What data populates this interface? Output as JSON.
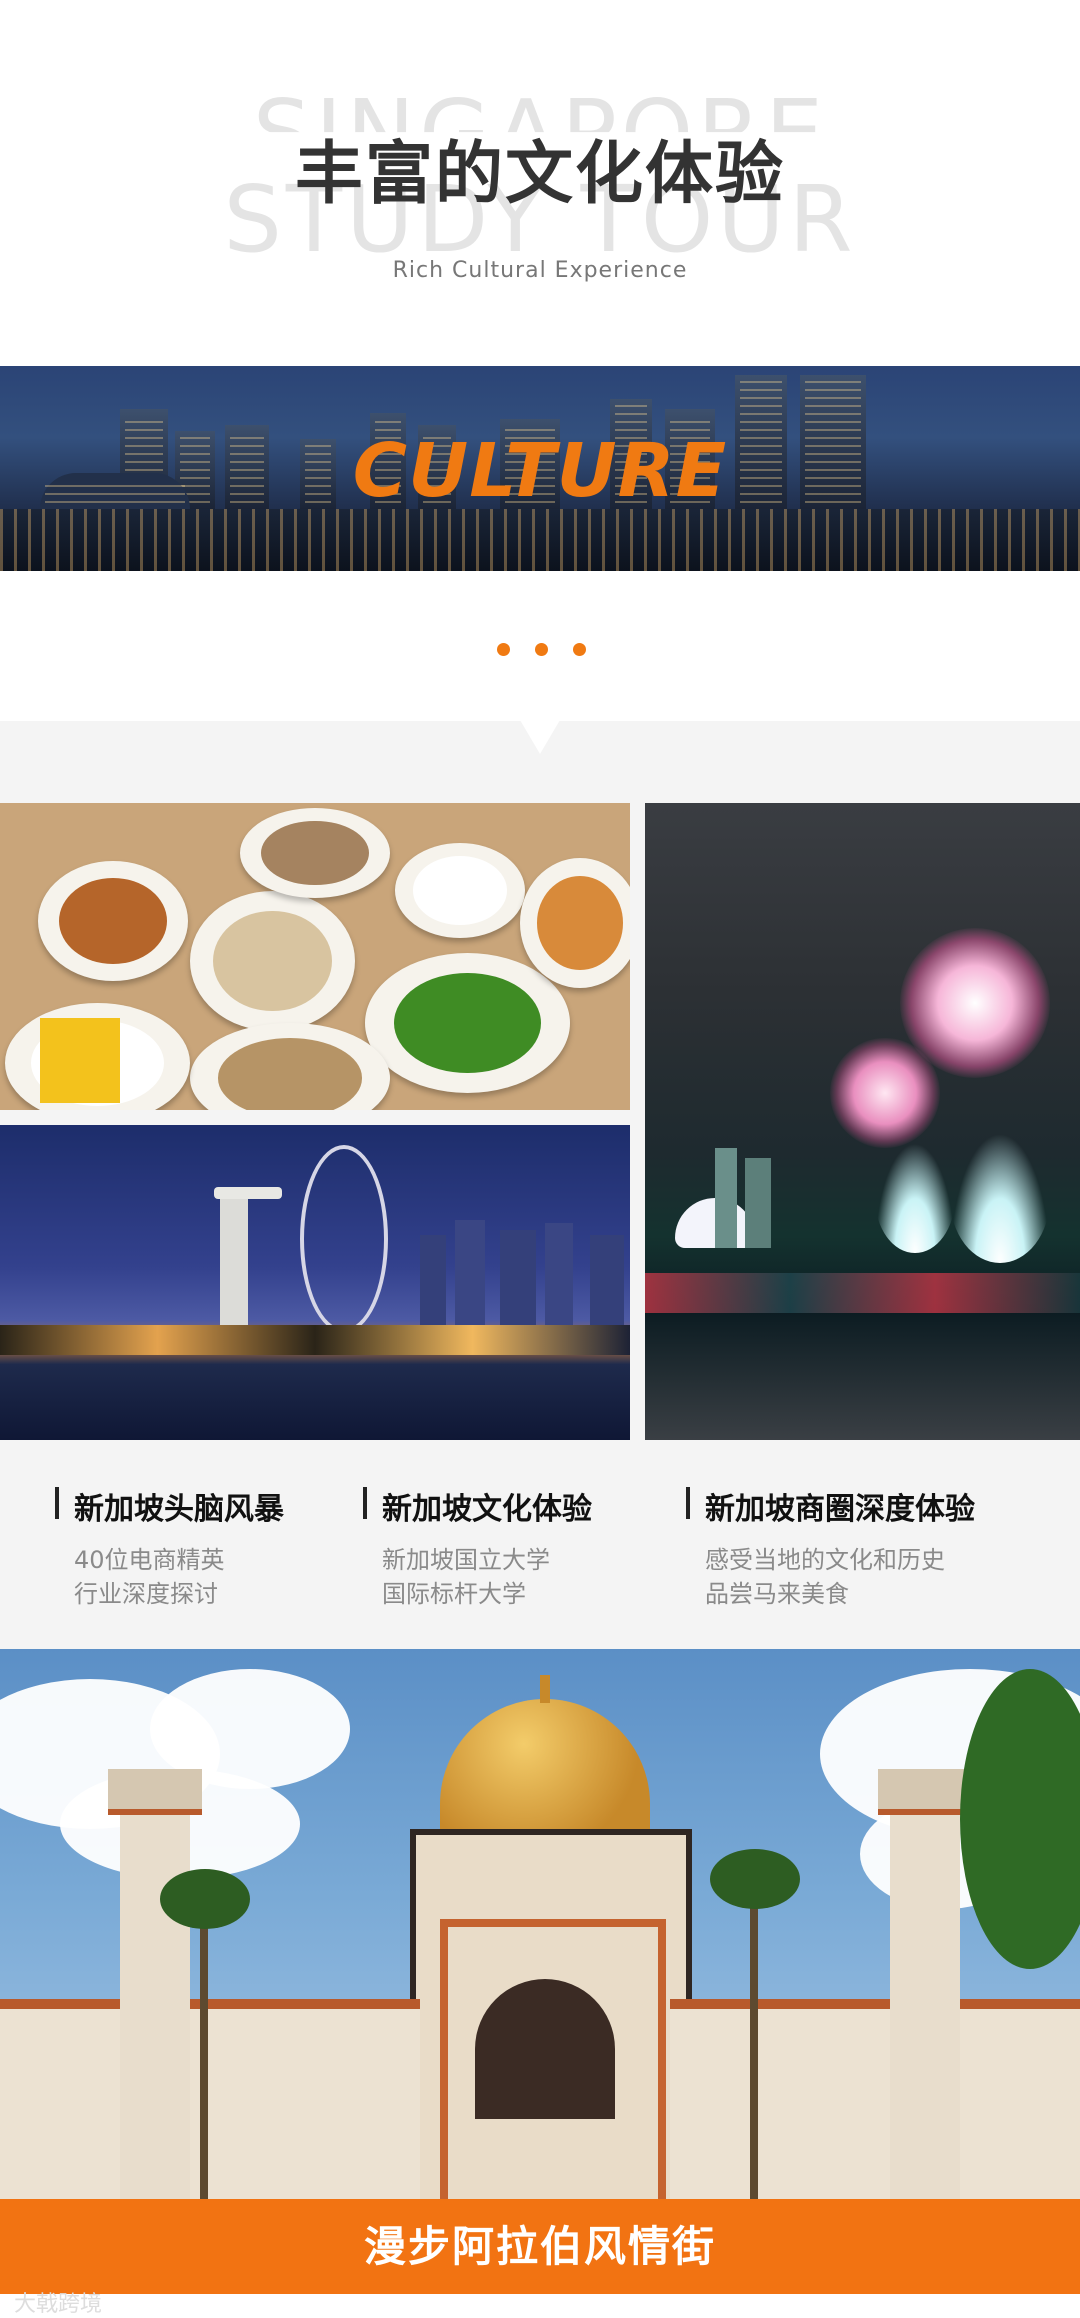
{
  "header": {
    "bg_line1": "SINGAPORE",
    "bg_line2": "STUDY TOUR",
    "title": "丰富的文化体验",
    "subtitle": "Rich Cultural Experience"
  },
  "banner": {
    "label": "CULTURE"
  },
  "columns": [
    {
      "title": "新加坡头脑风暴",
      "lines": [
        "40位电商精英",
        "行业深度探讨"
      ]
    },
    {
      "title": "新加坡文化体验",
      "lines": [
        "新加坡国立大学",
        "国际标杆大学"
      ]
    },
    {
      "title": "新加坡商圈深度体验",
      "lines": [
        "感受当地的文化和历史",
        "品尝马来美食"
      ]
    }
  ],
  "footer_banner": {
    "label": "漫步阿拉伯风情街"
  },
  "watermark": "大戟跨境",
  "colors": {
    "accent": "#f27312",
    "section_bg": "#f4f4f4",
    "title": "#333333"
  },
  "images": [
    "food-photo",
    "marina-bay-photo",
    "fireworks-photo",
    "mosque-photo"
  ]
}
